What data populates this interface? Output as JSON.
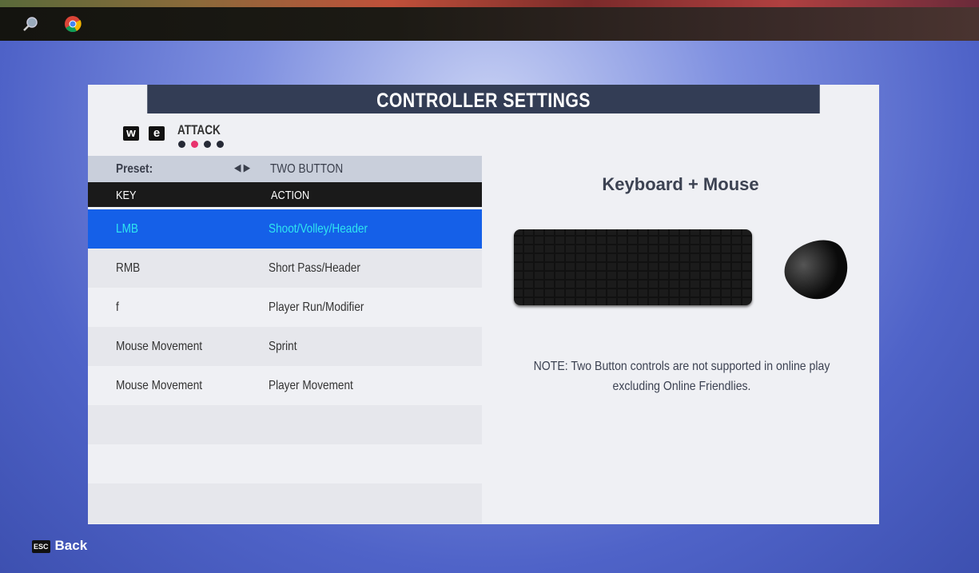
{
  "taskbar": {
    "icons": [
      "search-icon",
      "chrome-icon"
    ]
  },
  "title": "CONTROLLER SETTINGS",
  "tabs": {
    "prev_key": "w",
    "next_key": "e",
    "current": "ATTACK",
    "page_count": 4,
    "active_page": 2,
    "active_color": "#e8336e"
  },
  "preset": {
    "label": "Preset:",
    "value": "TWO BUTTON"
  },
  "table": {
    "headers": [
      "KEY",
      "ACTION"
    ],
    "rows": [
      {
        "key": "LMB",
        "action": "Shoot/Volley/Header",
        "selected": true
      },
      {
        "key": "RMB",
        "action": "Short Pass/Header"
      },
      {
        "key": "f",
        "action": "Player Run/Modifier"
      },
      {
        "key": "Mouse Movement",
        "action": "Sprint"
      },
      {
        "key": "Mouse Movement",
        "action": "Player Movement"
      },
      {
        "key": "",
        "action": ""
      },
      {
        "key": "",
        "action": ""
      },
      {
        "key": "",
        "action": ""
      }
    ]
  },
  "device": {
    "title": "Keyboard + Mouse",
    "note": "NOTE: Two Button controls are not supported in online play excluding Online Friendlies."
  },
  "footer": {
    "key": "ESC",
    "label": "Back"
  }
}
